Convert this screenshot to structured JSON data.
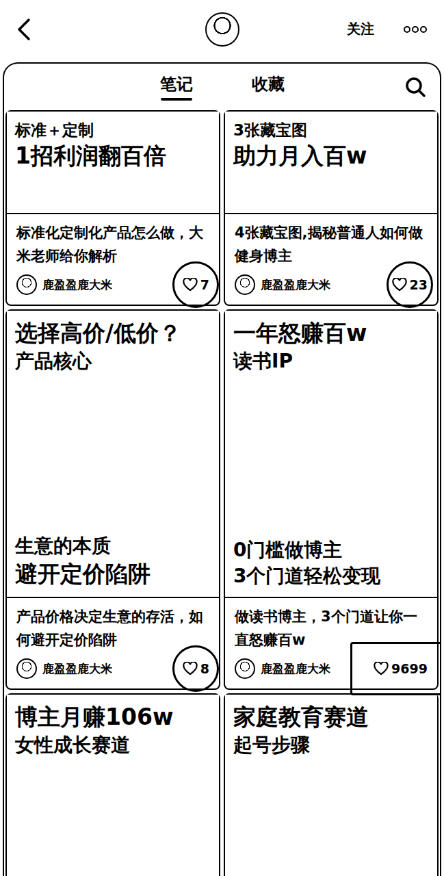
{
  "top_bar": {
    "follow_button": "关注"
  },
  "tabs": [
    {
      "label": "笔记",
      "selected": true
    },
    {
      "label": "收藏",
      "selected": false
    }
  ],
  "notes": [
    {
      "cover": {
        "top": [
          {
            "text": "标准＋定制",
            "kind": "small"
          },
          {
            "text": "1招利润翻百倍",
            "kind": "large"
          }
        ],
        "bottom": []
      },
      "caption": "标准化定制化产品怎么做，大米老师给你解析",
      "author": "鹿盈盈鹿大米",
      "likes": "7",
      "mark": "circle"
    },
    {
      "cover": {
        "top": [
          {
            "text": "3张藏宝图",
            "kind": "small"
          },
          {
            "text": "助力月入百w",
            "kind": "large"
          }
        ],
        "bottom": []
      },
      "caption": "4张藏宝图,揭秘普通人如何做健身博主",
      "author": "鹿盈盈鹿大米",
      "likes": "23",
      "mark": "circle"
    },
    {
      "cover": {
        "top": [
          {
            "text": "选择高价/低价？",
            "kind": "large"
          },
          {
            "text": "产品核心",
            "kind": "medium"
          }
        ],
        "bottom": [
          {
            "text": "生意的本质",
            "kind": "medium"
          },
          {
            "text": "避开定价陷阱",
            "kind": "large"
          }
        ]
      },
      "caption": "产品价格决定生意的存活，如何避开定价陷阱",
      "author": "鹿盈盈鹿大米",
      "likes": "8",
      "mark": "circle"
    },
    {
      "cover": {
        "top": [
          {
            "text": "一年怒赚百w",
            "kind": "large"
          },
          {
            "text": "读书IP",
            "kind": "medium"
          }
        ],
        "bottom": [
          {
            "text": "0门槛做博主",
            "kind": "medium"
          },
          {
            "text": "3个门道轻松变现",
            "kind": "medium"
          }
        ]
      },
      "caption": "做读书博主，3个门道让你一直怒赚百w",
      "author": "鹿盈盈鹿大米",
      "likes": "9699",
      "mark": "box"
    },
    {
      "cover": {
        "top": [
          {
            "text": "博主月赚106w",
            "kind": "large"
          },
          {
            "text": "女性成长赛道",
            "kind": "medium"
          }
        ],
        "bottom": []
      },
      "caption": "",
      "author": "",
      "likes": "",
      "mark": "none"
    },
    {
      "cover": {
        "top": [
          {
            "text": "家庭教育赛道",
            "kind": "large"
          },
          {
            "text": "起号步骤",
            "kind": "medium"
          }
        ],
        "bottom": []
      },
      "caption": "",
      "author": "",
      "likes": "",
      "mark": "none"
    }
  ]
}
